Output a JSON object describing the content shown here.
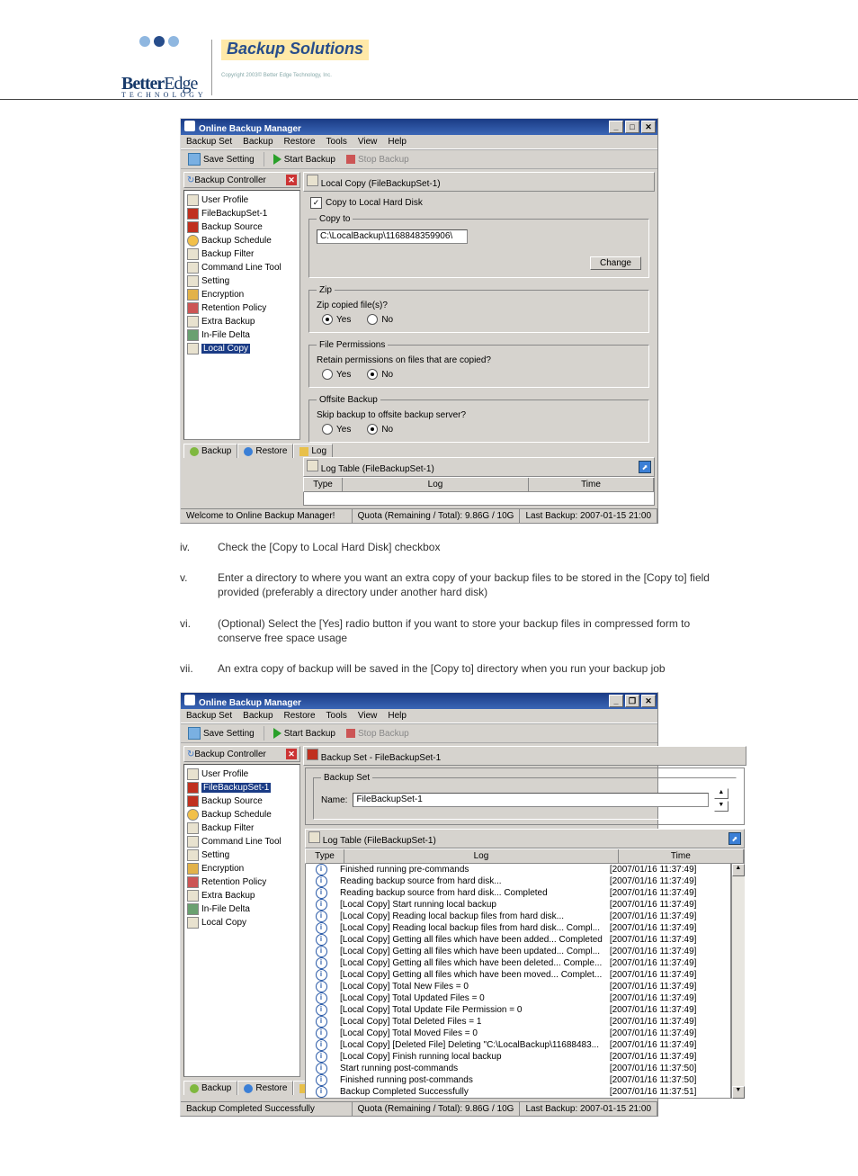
{
  "brand": {
    "name_a": "Better",
    "name_b": "Edge",
    "sub": "technology",
    "solutions": "Backup Solutions",
    "copyright": "Copyright 2003©\nBetter Edge Technology, Inc."
  },
  "steps": [
    {
      "n": "iv.",
      "t": "Check the [Copy to Local Hard Disk] checkbox"
    },
    {
      "n": "v.",
      "t": "Enter a directory to where you want an extra copy of your backup files to be stored in the [Copy to] field provided (preferably a directory under another hard disk)"
    },
    {
      "n": "vi.",
      "t": "(Optional) Select the [Yes] radio button if you want to store your backup files in compressed form to conserve free space usage"
    },
    {
      "n": "vii.",
      "t": "An extra copy of backup will be saved in the [Copy to] directory when you run your backup job"
    }
  ],
  "app": {
    "title": "Online Backup Manager",
    "menus": [
      "Backup Set",
      "Backup",
      "Restore",
      "Tools",
      "View",
      "Help"
    ],
    "toolbar": {
      "save": "Save Setting",
      "start": "Start Backup",
      "stop": "Stop Backup"
    },
    "side": {
      "title": "Backup Controller"
    },
    "tree_items": [
      {
        "lvl": 0,
        "ico": "file",
        "label": "User Profile"
      },
      {
        "lvl": 1,
        "ico": "folder",
        "label": "FileBackupSet-1"
      },
      {
        "lvl": 2,
        "ico": "folder",
        "label": "Backup Source"
      },
      {
        "lvl": 2,
        "ico": "sched",
        "label": "Backup Schedule"
      },
      {
        "lvl": 2,
        "ico": "file",
        "label": "Backup Filter"
      },
      {
        "lvl": 2,
        "ico": "file",
        "label": "Command Line Tool"
      },
      {
        "lvl": 2,
        "ico": "file",
        "label": "Setting"
      },
      {
        "lvl": 2,
        "ico": "lock",
        "label": "Encryption"
      },
      {
        "lvl": 2,
        "ico": "star",
        "label": "Retention Policy"
      },
      {
        "lvl": 2,
        "ico": "file",
        "label": "Extra Backup"
      },
      {
        "lvl": 2,
        "ico": "green",
        "label": "In-File Delta"
      },
      {
        "lvl": 2,
        "ico": "file",
        "label": "Local Copy",
        "sel": true
      }
    ],
    "tabs": {
      "backup": "Backup",
      "restore": "Restore",
      "log": "Log"
    },
    "pane1": {
      "head": "Local Copy (FileBackupSet-1)",
      "chk": "Copy to Local Hard Disk",
      "copyto_legend": "Copy to",
      "copyto_value": "C:\\LocalBackup\\1168848359906\\",
      "change": "Change",
      "zip_legend": "Zip",
      "zip_q": "Zip copied file(s)?",
      "perm_legend": "File Permissions",
      "perm_q": "Retain permissions on files that are copied?",
      "off_legend": "Offsite Backup",
      "off_q": "Skip backup to offsite backup server?",
      "yes": "Yes",
      "no": "No",
      "log_head": "Log Table (FileBackupSet-1)",
      "col_type": "Type",
      "col_log": "Log",
      "col_time": "Time"
    },
    "status1": "Welcome to Online Backup Manager!",
    "quota": "Quota (Remaining / Total): 9.86G / 10G",
    "last": "Last Backup: 2007-01-15 21:00"
  },
  "app2": {
    "title": "Online Backup Manager",
    "tree_items": [
      {
        "lvl": 0,
        "ico": "file",
        "label": "User Profile"
      },
      {
        "lvl": 1,
        "ico": "folder",
        "label": "FileBackupSet-1",
        "sel": true
      },
      {
        "lvl": 2,
        "ico": "folder",
        "label": "Backup Source"
      },
      {
        "lvl": 2,
        "ico": "sched",
        "label": "Backup Schedule"
      },
      {
        "lvl": 2,
        "ico": "file",
        "label": "Backup Filter"
      },
      {
        "lvl": 2,
        "ico": "file",
        "label": "Command Line Tool"
      },
      {
        "lvl": 2,
        "ico": "file",
        "label": "Setting"
      },
      {
        "lvl": 2,
        "ico": "lock",
        "label": "Encryption"
      },
      {
        "lvl": 2,
        "ico": "star",
        "label": "Retention Policy"
      },
      {
        "lvl": 2,
        "ico": "file",
        "label": "Extra Backup"
      },
      {
        "lvl": 2,
        "ico": "green",
        "label": "In-File Delta"
      },
      {
        "lvl": 2,
        "ico": "file",
        "label": "Local Copy"
      }
    ],
    "pane": {
      "head": "Backup Set - FileBackupSet-1",
      "bs_legend": "Backup Set",
      "name_label": "Name:",
      "name_value": "FileBackupSet-1",
      "log_head": "Log Table (FileBackupSet-1)",
      "col_type": "Type",
      "col_log": "Log",
      "col_time": "Time"
    },
    "logs": [
      {
        "msg": "Finished running pre-commands",
        "time": "[2007/01/16 11:37:49]"
      },
      {
        "msg": "Reading backup source from hard disk...",
        "time": "[2007/01/16 11:37:49]"
      },
      {
        "msg": "Reading backup source from hard disk... Completed",
        "time": "[2007/01/16 11:37:49]"
      },
      {
        "msg": "[Local Copy] Start running local backup",
        "time": "[2007/01/16 11:37:49]"
      },
      {
        "msg": "[Local Copy] Reading local backup files from hard disk...",
        "time": "[2007/01/16 11:37:49]"
      },
      {
        "msg": "[Local Copy] Reading local backup files from hard disk... Compl...",
        "time": "[2007/01/16 11:37:49]"
      },
      {
        "msg": "[Local Copy] Getting all files which have been added... Completed",
        "time": "[2007/01/16 11:37:49]"
      },
      {
        "msg": "[Local Copy] Getting all files which have been updated... Compl...",
        "time": "[2007/01/16 11:37:49]"
      },
      {
        "msg": "[Local Copy] Getting all files which have been deleted... Comple...",
        "time": "[2007/01/16 11:37:49]"
      },
      {
        "msg": "[Local Copy] Getting all files which have been moved... Complet...",
        "time": "[2007/01/16 11:37:49]"
      },
      {
        "msg": "[Local Copy] Total New Files = 0",
        "time": "[2007/01/16 11:37:49]"
      },
      {
        "msg": "[Local Copy] Total Updated Files = 0",
        "time": "[2007/01/16 11:37:49]"
      },
      {
        "msg": "[Local Copy] Total Update File Permission = 0",
        "time": "[2007/01/16 11:37:49]"
      },
      {
        "msg": "[Local Copy] Total Deleted Files = 1",
        "time": "[2007/01/16 11:37:49]"
      },
      {
        "msg": "[Local Copy] Total Moved Files = 0",
        "time": "[2007/01/16 11:37:49]"
      },
      {
        "msg": "[Local Copy] [Deleted File] Deleting \"C:\\LocalBackup\\11688483...",
        "time": "[2007/01/16 11:37:49]"
      },
      {
        "msg": "[Local Copy] Finish running local backup",
        "time": "[2007/01/16 11:37:49]"
      },
      {
        "msg": "Start running post-commands",
        "time": "[2007/01/16 11:37:50]"
      },
      {
        "msg": "Finished running post-commands",
        "time": "[2007/01/16 11:37:50]"
      },
      {
        "msg": "Backup Completed Successfully",
        "time": "[2007/01/16 11:37:51]"
      }
    ],
    "status": "Backup Completed Successfully"
  }
}
